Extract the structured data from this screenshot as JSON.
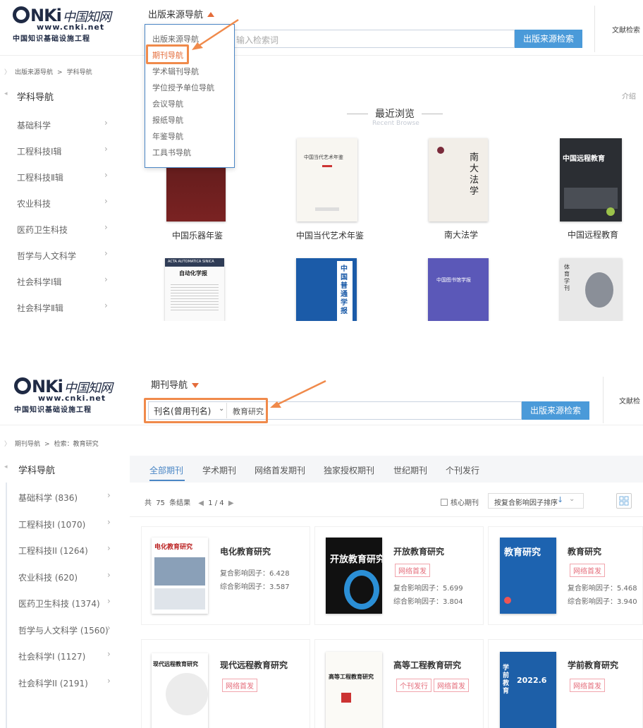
{
  "panel1": {
    "nav_dropdown_label": "出版来源导航",
    "search_placeholder": "输入检索词",
    "search_button": "出版来源检索",
    "top_right_link": "文献检索",
    "breadcrumb": [
      "出版来源导航",
      "学科导航"
    ],
    "sidebar_title": "学科导航",
    "sidebar_items": [
      "基础科学",
      "工程科技Ⅰ辑",
      "工程科技Ⅱ辑",
      "农业科技",
      "医药卫生科技",
      "哲学与人文科学",
      "社会科学Ⅰ辑",
      "社会科学Ⅱ辑"
    ],
    "intro_link": "介绍",
    "dropdown_items": [
      "出版来源导航",
      "期刊导航",
      "学术辑刊导航",
      "学位授予单位导航",
      "会议导航",
      "报纸导航",
      "年鉴导航",
      "工具书导航"
    ],
    "recent_title": "最近浏览",
    "recent_subtitle": "Recent Browse",
    "covers_row1": [
      {
        "title": "中国乐器年鉴",
        "cover_text": ""
      },
      {
        "title": "中国当代艺术年鉴",
        "cover_text": "中国当代艺术年鉴"
      },
      {
        "title": "南大法学",
        "cover_text": "南大法学"
      },
      {
        "title": "中国远程教育",
        "cover_text": "中国远程教育"
      }
    ],
    "covers_row2": [
      {
        "cover_text": "自动化学报",
        "cover_text2": "ACTA AUTOMATICA SINICA"
      },
      {
        "cover_text": "中国普通学报"
      },
      {
        "cover_text": "中国图书馆学报"
      },
      {
        "cover_text": "体育学刊"
      }
    ]
  },
  "panel2": {
    "nav_dropdown_label": "期刊导航",
    "field_select": "刊名(曾用刊名)",
    "search_value": "教育研究",
    "search_button": "出版来源检索",
    "top_right_link": "文献检",
    "breadcrumb": [
      "期刊导航",
      "检索：教育研究"
    ],
    "sidebar_title": "学科导航",
    "sidebar_items": [
      "基础科学 (836)",
      "工程科技I (1070)",
      "工程科技II (1264)",
      "农业科技 (620)",
      "医药卫生科技 (1374)",
      "哲学与人文科学 (1560)",
      "社会科学I (1127)",
      "社会科学II (2191)"
    ],
    "tabs": [
      "全部期刊",
      "学术期刊",
      "网络首发期刊",
      "独家授权期刊",
      "世纪期刊",
      "个刊发行"
    ],
    "result_prefix": "共",
    "result_count": "75",
    "result_suffix": "条结果",
    "pager": "1 / 4",
    "core_checkbox": "核心期刊",
    "sort_select": "按复合影响因子排序",
    "journals": [
      {
        "title": "电化教育研究",
        "badges": [],
        "m1": "复合影响因子：6.428",
        "m2": "综合影响因子：3.587",
        "cover": "电化教育研究"
      },
      {
        "title": "开放教育研究",
        "badges": [
          "网络首发"
        ],
        "m1": "复合影响因子：5.699",
        "m2": "综合影响因子：3.804",
        "cover": "开放教育研究"
      },
      {
        "title": "教育研究",
        "badges": [
          "网络首发"
        ],
        "m1": "复合影响因子：5.468",
        "m2": "综合影响因子：3.940",
        "cover": "教育研究"
      },
      {
        "title": "现代远程教育研究",
        "badges": [
          "网络首发"
        ],
        "cover": "现代远程教育研究"
      },
      {
        "title": "高等工程教育研究",
        "badges": [
          "个刊发行",
          "网络首发"
        ],
        "cover": "高等工程教育研究"
      },
      {
        "title": "学前教育研究",
        "badges": [
          "网络首发"
        ],
        "cover": "学前教育",
        "cover2": "2022.6"
      }
    ]
  },
  "logo": {
    "hanzi": "中国知网",
    "url": "www.cnki.net",
    "tagline": "中国知识基础设施工程"
  },
  "colors": {
    "accent_orange": "#f08a4b",
    "link_blue": "#4a86c5",
    "button_blue": "#4a9ad9",
    "badge_pink": "#e46c7a"
  }
}
